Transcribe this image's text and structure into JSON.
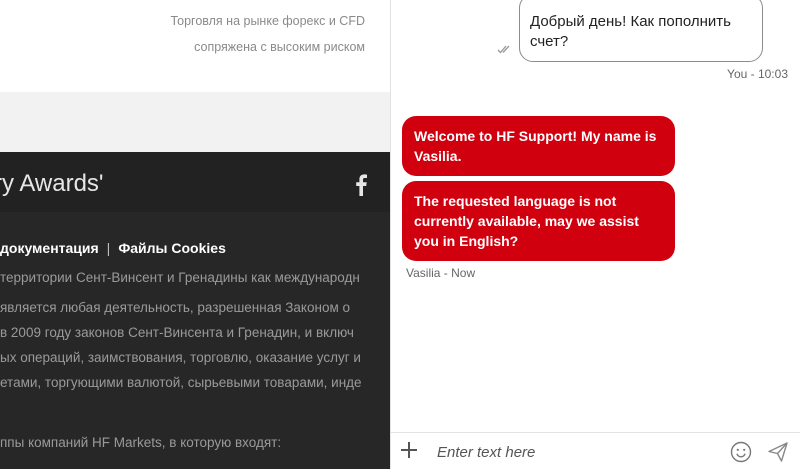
{
  "site": {
    "risk_warning": [
      "Торговля на рынке форекс и CFD",
      "сопряжена с высоким риском"
    ],
    "footer_title": "ry Awards'",
    "footer_links": [
      "документация",
      "Файлы Cookies"
    ],
    "link_separator": "|",
    "legal_lines": [
      "территории Сент-Винсент и Гренадины как международн",
      "является любая деятельность, разрешенная Законом о",
      "в 2009 году законов Сент-Винсента и Гренадин, и включ",
      "ых операций, заимствования, торговлю, оказание услуг и",
      "етами, торгующими валютой, сырьевыми товарами, инде",
      "ппы компаний HF Markets, в которую входят:"
    ]
  },
  "chat": {
    "messages": [
      {
        "sender": "You",
        "time": "10:03",
        "meta": "You - 10:03",
        "text": "Добрый день! Как пополнить счет?"
      },
      {
        "sender": "Vasilia",
        "text": "Welcome to HF Support! My name is Vasilia."
      },
      {
        "sender": "Vasilia",
        "text": "The requested language is not currently available, may we assist you in English?"
      }
    ],
    "agent_meta": "Vasilia - Now",
    "input_placeholder": "Enter text here",
    "input_value": ""
  },
  "colors": {
    "accent": "#d0000f",
    "footer_bg": "#272727",
    "footer_head_bg": "#222222"
  },
  "icons": [
    "double-check-icon",
    "facebook-icon",
    "plus-icon",
    "smile-icon",
    "send-icon"
  ]
}
